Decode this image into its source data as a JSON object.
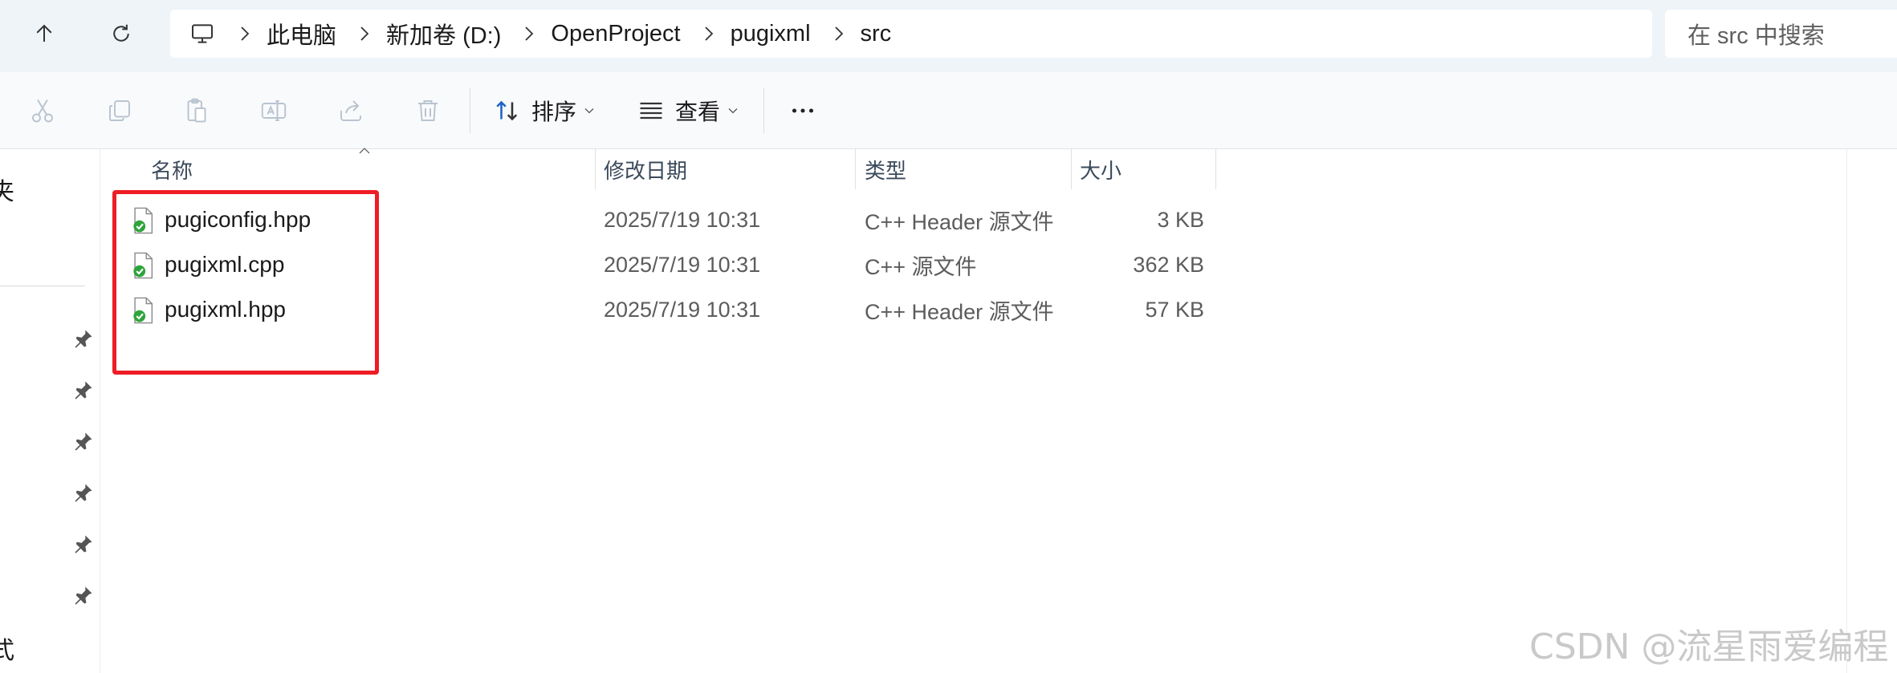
{
  "address_bar": {
    "crumbs": [
      "此电脑",
      "新加卷 (D:)",
      "OpenProject",
      "pugixml",
      "src"
    ],
    "search_placeholder": "在 src 中搜索"
  },
  "toolbar": {
    "sort_label": "排序",
    "view_label": "查看"
  },
  "sidebar": {
    "partial_top": "夹",
    "partial_bottom": "式"
  },
  "columns": {
    "name": "名称",
    "date": "修改日期",
    "type": "类型",
    "size": "大小"
  },
  "files": [
    {
      "name": "pugiconfig.hpp",
      "date": "2025/7/19 10:31",
      "type": "C++ Header 源文件",
      "size": "3 KB"
    },
    {
      "name": "pugixml.cpp",
      "date": "2025/7/19 10:31",
      "type": "C++ 源文件",
      "size": "362 KB"
    },
    {
      "name": "pugixml.hpp",
      "date": "2025/7/19 10:31",
      "type": "C++ Header 源文件",
      "size": "57 KB"
    }
  ],
  "watermark": "CSDN @流星雨爱编程",
  "colors": {
    "highlight_border": "#ee1c25",
    "sync_check_green": "#2ea43b",
    "sort_icon_blue": "#1f63c6",
    "topbar_bg": "#eff4f9"
  }
}
